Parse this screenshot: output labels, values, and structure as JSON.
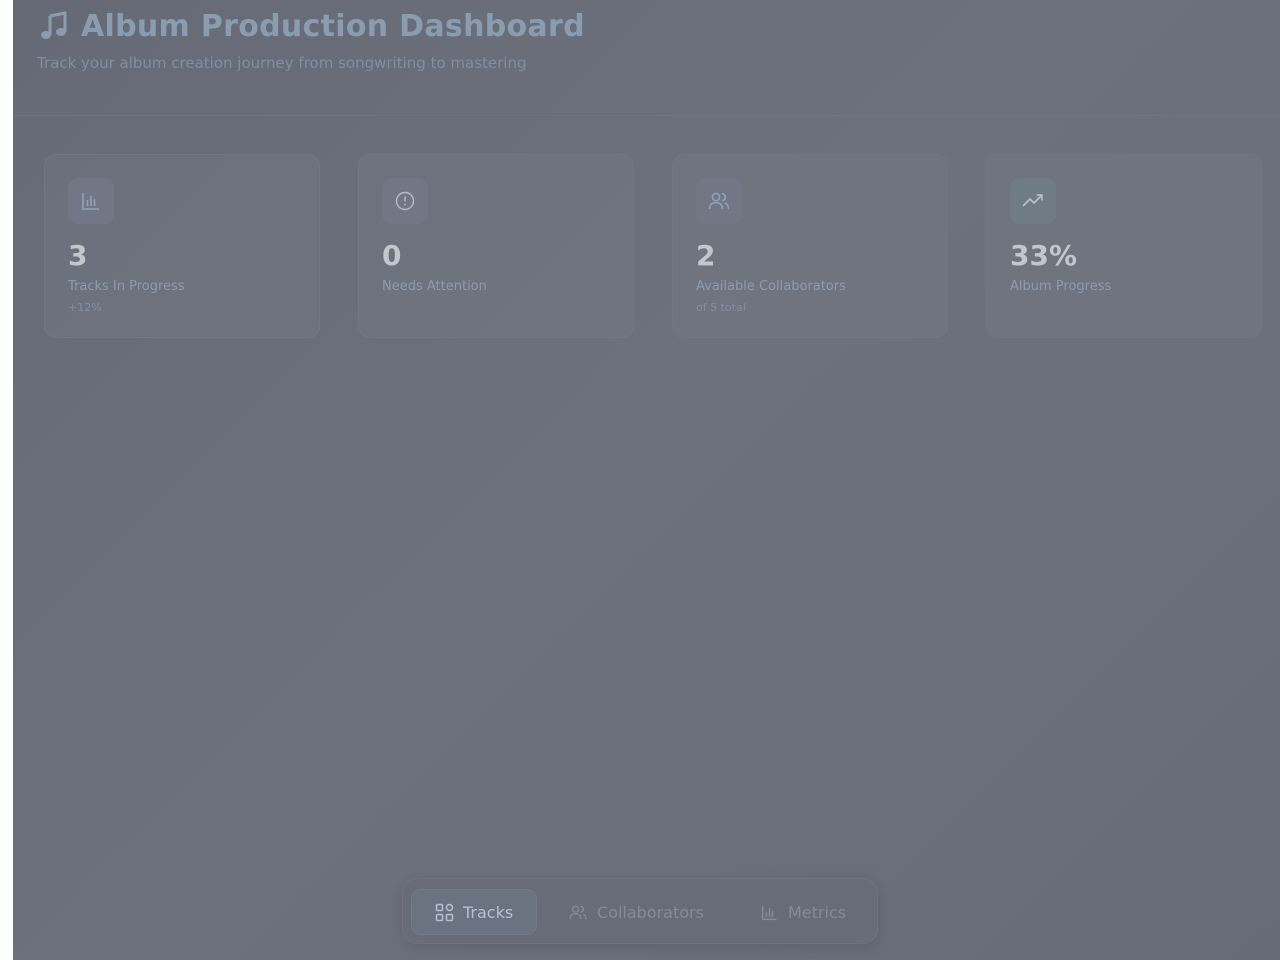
{
  "header": {
    "title": "Album Production Dashboard",
    "title_icon": "music-note-icon",
    "subtitle": "Track your album creation journey from songwriting to mastering"
  },
  "stats": [
    {
      "icon": "bar-chart-icon",
      "value": "3",
      "label": "Tracks In Progress",
      "sub": "+12%"
    },
    {
      "icon": "alert-circle-icon",
      "value": "0",
      "label": "Needs Attention",
      "sub": ""
    },
    {
      "icon": "users-icon",
      "value": "2",
      "label": "Available Collaborators",
      "sub": "of 5 total"
    },
    {
      "icon": "trending-up-icon",
      "value": "33%",
      "label": "Album Progress",
      "sub": ""
    }
  ],
  "nav": {
    "active": "Tracks",
    "items": [
      {
        "icon": "grid-icon",
        "label": "Tracks"
      },
      {
        "icon": "users-icon",
        "label": "Collaborators"
      },
      {
        "icon": "bar-chart-icon",
        "label": "Metrics"
      }
    ]
  },
  "colors": {
    "accent": "#8a9db0",
    "background": "#6b6f7a",
    "card_value": "#c3c6cd"
  }
}
